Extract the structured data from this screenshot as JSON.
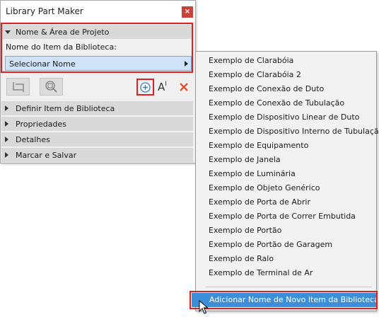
{
  "window": {
    "title": "Library Part Maker",
    "close_glyph": "×"
  },
  "section_open": {
    "label": "Nome & Área de Projeto"
  },
  "name_field": {
    "label": "Nome do Item da Biblioteca:",
    "value": "Selecionar Nome"
  },
  "toolbar": {
    "icons": [
      "crop-icon",
      "zoom-icon",
      "add-circle-icon",
      "text-style-icon",
      "delete-x-icon"
    ],
    "text_icon_glyph": "A"
  },
  "sections": [
    {
      "label": "Definir Item de Biblioteca"
    },
    {
      "label": "Propriedades"
    },
    {
      "label": "Detalhes"
    },
    {
      "label": "Marcar e Salvar"
    }
  ],
  "dropdown": {
    "items": [
      "Exemplo de Clarabóia",
      "Exemplo de Clarabóia 2",
      "Exemplo de Conexão de Duto",
      "Exemplo de Conexão de Tubulação",
      "Exemplo de Dispositivo Linear de Duto",
      "Exemplo de Dispositivo Interno de Tubulação",
      "Exemplo de Equipamento",
      "Exemplo de Janela",
      "Exemplo de Luminária",
      "Exemplo de Objeto Genérico",
      "Exemplo de Porta de Abrir",
      "Exemplo de Porta de Correr Embutida",
      "Exemplo de Portão",
      "Exemplo de Portão de Garagem",
      "Exemplo de Ralo",
      "Exemplo de Terminal de Ar"
    ],
    "highlighted": "Adicionar Nome de Novo Item da Biblioteca..."
  },
  "colors": {
    "highlight": "#3d8ed8",
    "annotation_red": "#e02020",
    "select_bg": "#cfe2f7",
    "close_bg": "#c8423c",
    "delete_red": "#e8431f",
    "add_blue": "#2a7fd4"
  }
}
